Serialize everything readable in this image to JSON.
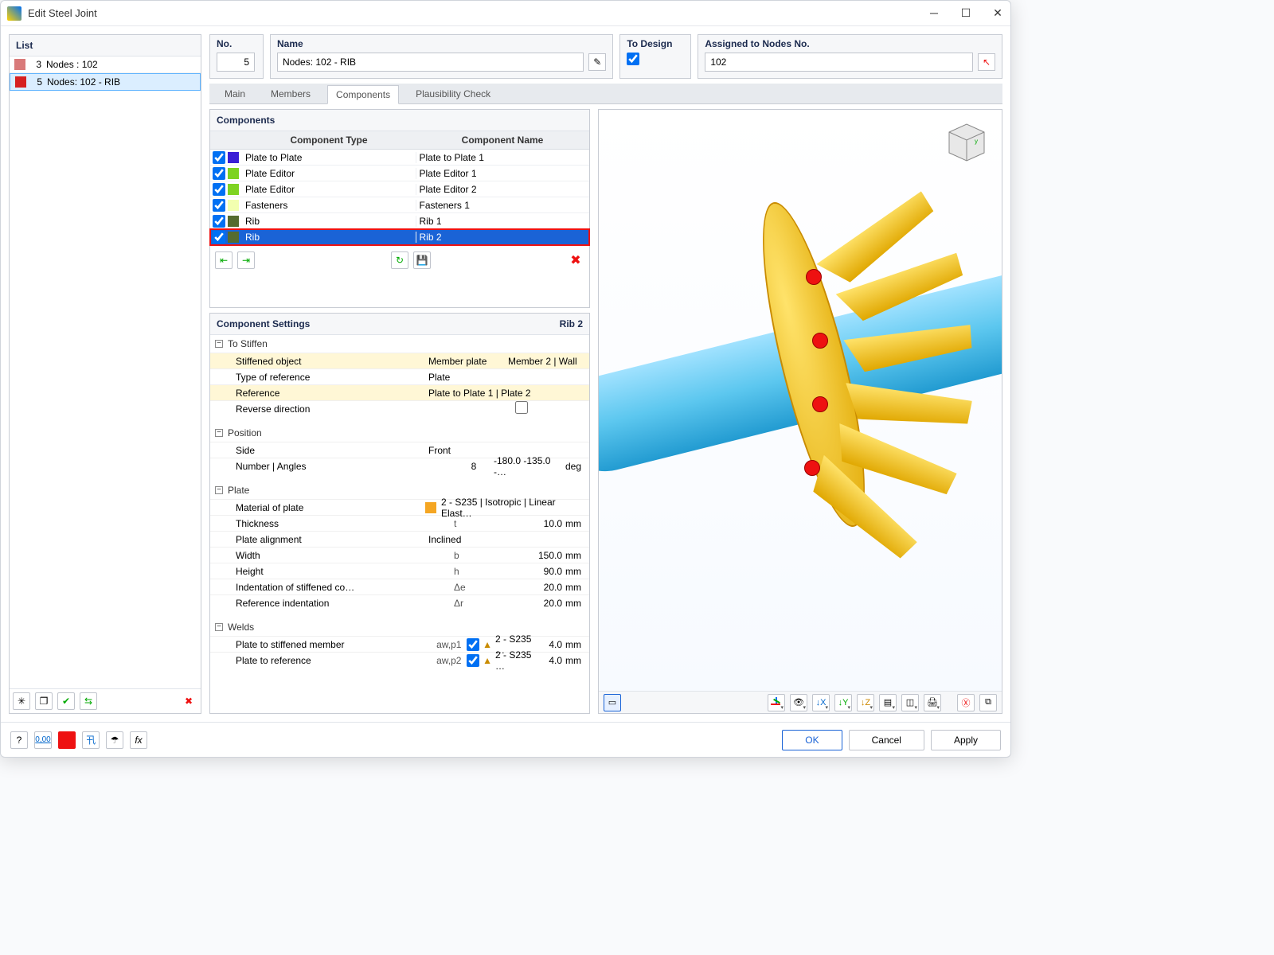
{
  "window": {
    "title": "Edit Steel Joint"
  },
  "leftList": {
    "header": "List",
    "items": [
      {
        "num": "3",
        "label": "Nodes : 102",
        "color": "#d97a7a",
        "selected": false
      },
      {
        "num": "5",
        "label": "Nodes: 102 - RIB",
        "color": "#d62020",
        "selected": true
      }
    ]
  },
  "fields": {
    "no": {
      "label": "No.",
      "value": "5"
    },
    "name": {
      "label": "Name",
      "value": "Nodes: 102 - RIB"
    },
    "design": {
      "label": "To Design",
      "checked": true
    },
    "assigned": {
      "label": "Assigned to Nodes No.",
      "value": "102"
    }
  },
  "tabs": [
    "Main",
    "Members",
    "Components",
    "Plausibility Check"
  ],
  "activeTab": "Components",
  "componentsPanel": {
    "header": "Components",
    "cols": {
      "type": "Component Type",
      "name": "Component Name"
    },
    "rows": [
      {
        "color": "#3a1ed6",
        "type": "Plate to Plate",
        "name": "Plate to Plate 1"
      },
      {
        "color": "#7ed321",
        "type": "Plate Editor",
        "name": "Plate Editor 1"
      },
      {
        "color": "#7ed321",
        "type": "Plate Editor",
        "name": "Plate Editor 2"
      },
      {
        "color": "#f2ffb0",
        "type": "Fasteners",
        "name": "Fasteners 1"
      },
      {
        "color": "#556b2f",
        "type": "Rib",
        "name": "Rib 1"
      },
      {
        "color": "#556b2f",
        "type": "Rib",
        "name": "Rib 2"
      }
    ]
  },
  "settingsPanel": {
    "header": "Component Settings",
    "right": "Rib 2",
    "sections": {
      "toStiffen": {
        "title": "To Stiffen",
        "stiffened_label": "Stiffened object",
        "stiffened_v1": "Member plate",
        "stiffened_v2": "Member 2 | Wall",
        "typeRef_label": "Type of reference",
        "typeRef_val": "Plate",
        "reference_label": "Reference",
        "reference_val": "Plate to Plate 1 | Plate  2",
        "reverse_label": "Reverse direction"
      },
      "position": {
        "title": "Position",
        "side_label": "Side",
        "side_val": "Front",
        "numang_label": "Number | Angles",
        "num": "8",
        "angles": "-180.0 -135.0 -…",
        "unit": "deg"
      },
      "plate": {
        "title": "Plate",
        "material_label": "Material of plate",
        "material_val": "2 - S235 | Isotropic | Linear Elast…",
        "thickness_label": "Thickness",
        "thickness_sym": "t",
        "thickness_val": "10.0",
        "thickness_unit": "mm",
        "align_label": "Plate alignment",
        "align_val": "Inclined",
        "width_label": "Width",
        "width_sym": "b",
        "width_val": "150.0",
        "width_unit": "mm",
        "height_label": "Height",
        "height_sym": "h",
        "height_val": "90.0",
        "height_unit": "mm",
        "indent1_label": "Indentation of stiffened co…",
        "indent1_sym": "Δe",
        "indent1_val": "20.0",
        "indent1_unit": "mm",
        "indent2_label": "Reference indentation",
        "indent2_sym": "Δr",
        "indent2_val": "20.0",
        "indent2_unit": "mm"
      },
      "welds": {
        "title": "Welds",
        "w1_label": "Plate to stiffened member",
        "w1_sym": "aw,p1",
        "w1_mat": "2 - S235 …",
        "w1_val": "4.0",
        "w1_unit": "mm",
        "w2_label": "Plate to reference",
        "w2_sym": "aw,p2",
        "w2_mat": "2 - S235 …",
        "w2_val": "4.0",
        "w2_unit": "mm"
      }
    }
  },
  "footer": {
    "ok": "OK",
    "cancel": "Cancel",
    "apply": "Apply"
  }
}
